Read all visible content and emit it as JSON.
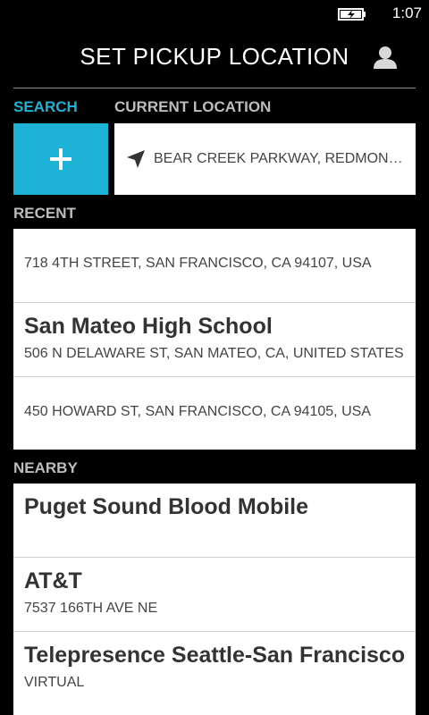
{
  "status_bar": {
    "time": "1:07",
    "battery_icon": "battery-charging-icon"
  },
  "header": {
    "title": "SET PICKUP LOCATION",
    "account_icon": "person-icon"
  },
  "tabs": {
    "search_label": "SEARCH",
    "current_location_label": "CURRENT LOCATION"
  },
  "search": {
    "add_icon": "plus-icon"
  },
  "current_location": {
    "icon": "location-arrow-icon",
    "text": "BEAR CREEK PARKWAY, REDMOND, WA"
  },
  "recent": {
    "label": "RECENT",
    "items": [
      {
        "title": "",
        "address": "718 4TH STREET, SAN FRANCISCO, CA 94107, USA"
      },
      {
        "title": "San Mateo High School",
        "address": "506 N DELAWARE ST, SAN MATEO, CA, UNITED STATES"
      },
      {
        "title": "",
        "address": "450 HOWARD ST, SAN FRANCISCO, CA 94105, USA"
      }
    ]
  },
  "nearby": {
    "label": "NEARBY",
    "items": [
      {
        "title": "Puget Sound Blood Mobile",
        "address": ""
      },
      {
        "title": "AT&T",
        "address": "7537 166TH AVE NE"
      },
      {
        "title": "Telepresence Seattle-San Francisco",
        "address": "VIRTUAL"
      }
    ]
  },
  "colors": {
    "accent": "#1eb2d6",
    "background": "#000000",
    "card": "#ffffff"
  }
}
